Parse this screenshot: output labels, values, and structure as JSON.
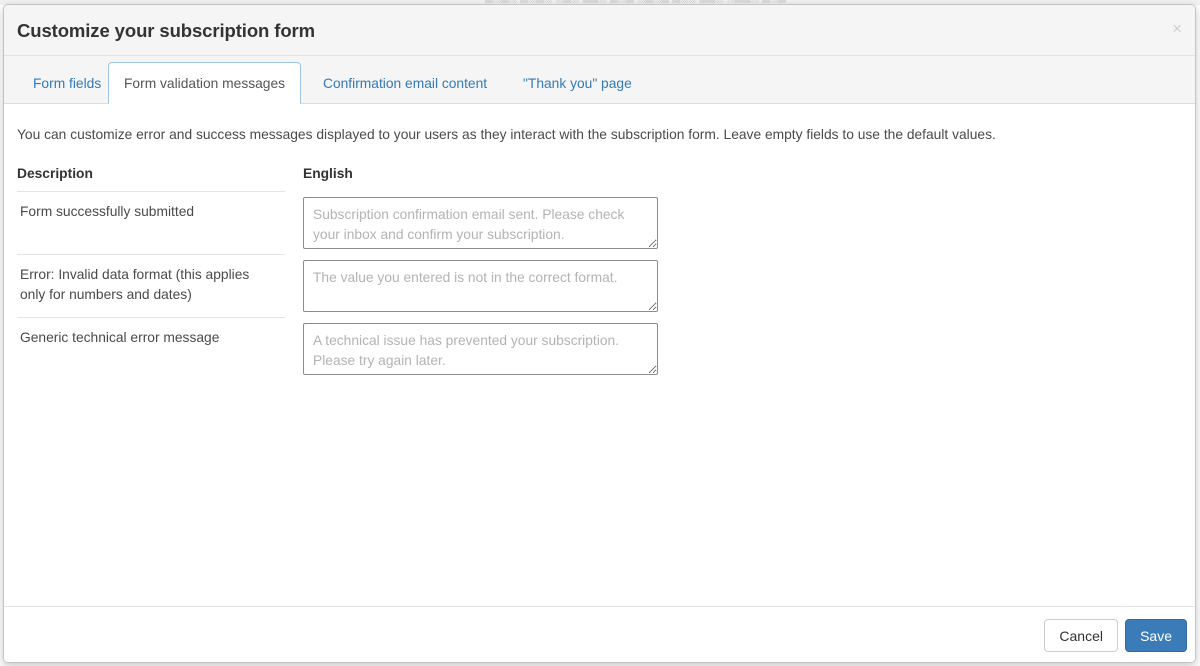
{
  "background": {
    "ghost_text": "▒░▒░ ▒░▒░ ░▒░ ▒▒░ ▒░▒ ░▒░▒ ▒░░ ▒▒░ ░▒▒░ ▒░▒"
  },
  "dialog": {
    "title": "Customize your subscription form",
    "close_icon": "×"
  },
  "tabs": [
    {
      "label": "Form fields",
      "active": false
    },
    {
      "label": "Form validation messages",
      "active": true
    },
    {
      "label": "Confirmation email content",
      "active": false
    },
    {
      "label": "\"Thank you\" page",
      "active": false
    }
  ],
  "body": {
    "intro": "You can customize error and success messages displayed to your users as they interact with the subscription form. Leave empty fields to use the default values.",
    "table": {
      "headers": {
        "description": "Description",
        "english": "English"
      },
      "rows": [
        {
          "description": "Form successfully submitted",
          "value": "",
          "placeholder": "Subscription confirmation email sent. Please check your inbox and confirm your subscription."
        },
        {
          "description": "Error: Invalid data format (this applies only for numbers and dates)",
          "value": "",
          "placeholder": "The value you entered is not in the correct format."
        },
        {
          "description": "Generic technical error message",
          "value": "",
          "placeholder": "A technical issue has prevented your subscription. Please try again later."
        }
      ]
    }
  },
  "footer": {
    "cancel_label": "Cancel",
    "save_label": "Save"
  },
  "colors": {
    "primary": "#3b7cb8",
    "link": "#337ab7",
    "tab_active_border": "#9ec5e3",
    "header_bg": "#f5f5f5"
  }
}
